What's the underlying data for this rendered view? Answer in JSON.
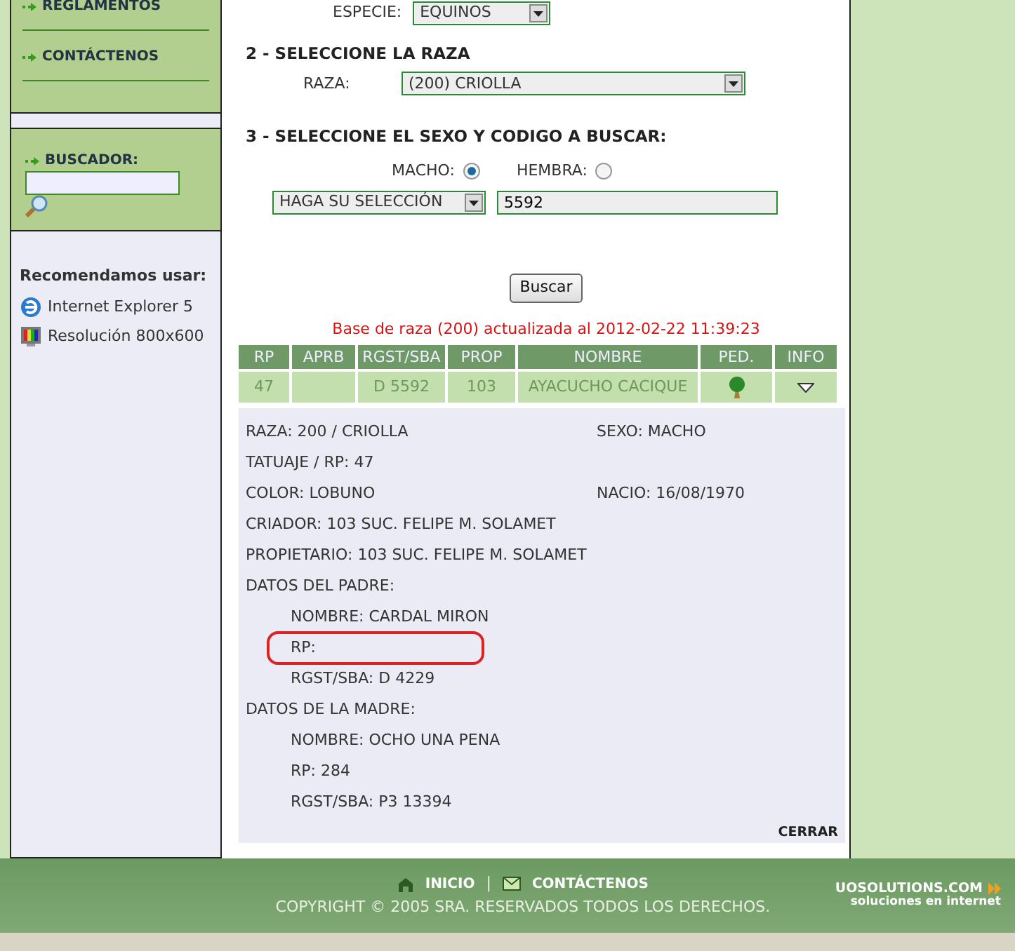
{
  "sidebar": {
    "menu": [
      {
        "label": "REGLAMENTOS"
      },
      {
        "label": "CONTÁCTENOS"
      }
    ],
    "search": {
      "label": "BUSCADOR:"
    },
    "recommend": {
      "title": "Recomendamos usar:",
      "items": [
        {
          "kind": "browser",
          "label": "Internet Explorer 5"
        },
        {
          "kind": "monitor",
          "label": "Resolución 800x600"
        }
      ]
    }
  },
  "form": {
    "species": {
      "label": "ESPECIE:",
      "value": "EQUINOS"
    },
    "step2": "2 - SELECCIONE LA RAZA",
    "breed": {
      "label": "RAZA:",
      "value": "(200) CRIOLLA"
    },
    "step3": "3 - SELECCIONE EL SEXO Y CODIGO A BUSCAR:",
    "sex": [
      {
        "label": "MACHO:",
        "selected": true
      },
      {
        "label": "HEMBRA:",
        "selected": false
      }
    ],
    "code_type": "HAGA SU SELECCIÓN",
    "code": "5592",
    "button": "Buscar"
  },
  "status": "Base de raza (200) actualizada al 2012-02-22 11:39:23",
  "table": {
    "columns": [
      "RP",
      "APRB",
      "RGST/SBA",
      "PROP",
      "NOMBRE",
      "PED.",
      "INFO"
    ],
    "rows": [
      {
        "rp": "47",
        "rgst_sba": "D 5592",
        "prop": "103",
        "nombre": "AYACUCHO CACIQUE"
      }
    ]
  },
  "detail": {
    "rows": [
      {
        "left": "RAZA: 200 / CRIOLLA",
        "right": "SEXO: MACHO"
      },
      {
        "left": "TATUAJE / RP: 47"
      },
      {
        "left": "COLOR: LOBUNO",
        "right": "NACIO: 16/08/1970"
      },
      {
        "left": "CRIADOR: 103 SUC. FELIPE M. SOLAMET"
      },
      {
        "left": "PROPIETARIO: 103 SUC. FELIPE M. SOLAMET"
      },
      {
        "left": "DATOS DEL PADRE:"
      },
      {
        "kind": "sub",
        "left": "NOMBRE: CARDAL MIRON"
      },
      {
        "kind": "sub",
        "left": "RP:",
        "highlighted": true
      },
      {
        "kind": "sub",
        "left": "RGST/SBA: D 4229"
      },
      {
        "left": "DATOS DE LA MADRE:"
      },
      {
        "kind": "sub",
        "left": "NOMBRE: OCHO UNA PENA"
      },
      {
        "kind": "sub",
        "left": "RP: 284"
      },
      {
        "kind": "sub",
        "left": "RGST/SBA: P3 13394"
      }
    ],
    "close": "CERRAR"
  },
  "footer": {
    "links": [
      {
        "kind": "home",
        "label": "INICIO"
      },
      {
        "kind": "mail",
        "label": "CONTÁCTENOS"
      }
    ],
    "separator": "|",
    "copyright": "COPYRIGHT © 2005 SRA. RESERVADOS TODOS LOS DERECHOS.",
    "brand": "UOSOLUTIONS.COM",
    "tagline": "soluciones en internet"
  }
}
